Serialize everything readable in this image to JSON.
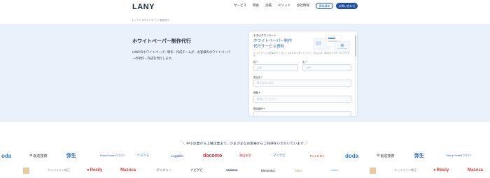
{
  "header": {
    "logo": "LANY",
    "nav": [
      "サービス",
      "特長",
      "実績",
      "メソッド",
      "会社情報",
      "採用情報"
    ],
    "btn_download": "資料請求",
    "btn_contact": "お問い合わせ"
  },
  "breadcrumb": "トップ ＞ ホワイトペーパー制作代行",
  "hero": {
    "title": "ホワイトペーパー制作代行",
    "desc": "LANYのホワイトペーパー制作・作成チームが、お客様のホワイトペーパーの制作・作成を代行します。"
  },
  "form": {
    "pre": "まずはダウンロード",
    "title": "ホワイトペーパー制作代行サービス資料",
    "small": "以下のフォームに必要事項をご入力の上、送信ボタンを押してください。送信完了後、資料をダウンロードいただけます。",
    "last_name_label": "姓 *",
    "last_name_placeholder": "山田",
    "first_name_label": "名 *",
    "first_name_placeholder": "太郎",
    "company_label": "会社名 *",
    "company_placeholder": "株式会社XXXX",
    "position_label": "役職 *",
    "position_placeholder": "選択してください",
    "phone_label": "電話番号 *",
    "accent": "#1e5fb4"
  },
  "clients": {
    "title": "＼ 中小企業から上場企業まで、さまざまなお客様からご好評をいただいています ／",
    "row1": [
      "oda",
      "創造技術",
      "弥生",
      "Money Forward クラウド",
      "ナヨクモ",
      "LegalOn",
      "docomo",
      "森田化学",
      "マイナビ",
      "PALONA",
      "doda",
      "創造技術",
      "弥生",
      "Money Forward クラウド"
    ],
    "row2": [
      "",
      "キレイライン矯正",
      "Resily",
      "Mazrica",
      "ジンジャー",
      "ナビゲビ",
      "SAMURAI",
      "Electrolux",
      "RIKO",
      "chatbot",
      "",
      "キレイライン矯正",
      "Resily",
      "Mazrica"
    ]
  }
}
